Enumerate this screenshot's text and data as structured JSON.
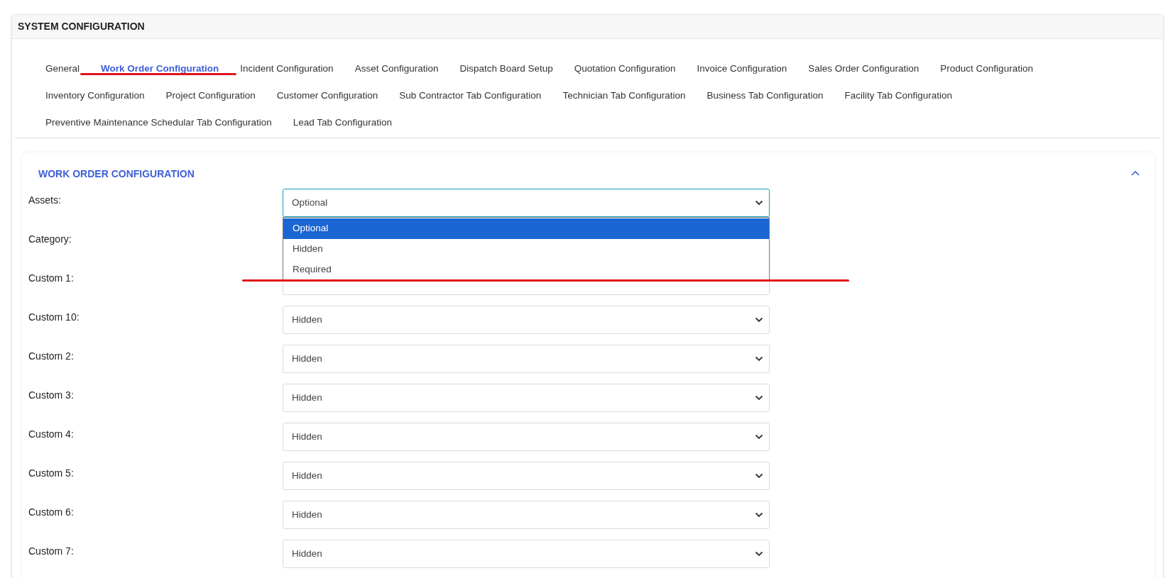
{
  "page_title": "SYSTEM CONFIGURATION",
  "tabs": [
    {
      "label": "General",
      "selected": false
    },
    {
      "label": "Work Order Configuration",
      "selected": true
    },
    {
      "label": "Incident Configuration",
      "selected": false
    },
    {
      "label": "Asset Configuration",
      "selected": false
    },
    {
      "label": "Dispatch Board Setup",
      "selected": false
    },
    {
      "label": "Quotation Configuration",
      "selected": false
    },
    {
      "label": "Invoice Configuration",
      "selected": false
    },
    {
      "label": "Sales Order Configuration",
      "selected": false
    },
    {
      "label": "Product Configuration",
      "selected": false
    },
    {
      "label": "Inventory Configuration",
      "selected": false
    },
    {
      "label": "Project Configuration",
      "selected": false
    },
    {
      "label": "Customer Configuration",
      "selected": false
    },
    {
      "label": "Sub Contractor Tab Configuration",
      "selected": false
    },
    {
      "label": "Technician Tab Configuration",
      "selected": false
    },
    {
      "label": "Business Tab Configuration",
      "selected": false
    },
    {
      "label": "Facility Tab Configuration",
      "selected": false
    },
    {
      "label": "Preventive Maintenance Schedular Tab Configuration",
      "selected": false
    },
    {
      "label": "Lead Tab Configuration",
      "selected": false
    }
  ],
  "section": {
    "title": "WORK ORDER CONFIGURATION",
    "expanded": true,
    "fields": [
      {
        "label": "Assets:",
        "value": "Optional",
        "focused": true,
        "open": true,
        "options": [
          {
            "label": "Optional",
            "selected": true
          },
          {
            "label": "Hidden",
            "selected": false
          },
          {
            "label": "Required",
            "selected": false
          }
        ]
      },
      {
        "label": "Category:"
      },
      {
        "label": "Custom 1:"
      },
      {
        "label": "Custom 10:",
        "value": "Hidden"
      },
      {
        "label": "Custom 2:",
        "value": "Hidden"
      },
      {
        "label": "Custom 3:",
        "value": "Hidden"
      },
      {
        "label": "Custom 4:",
        "value": "Hidden"
      },
      {
        "label": "Custom 5:",
        "value": "Hidden"
      },
      {
        "label": "Custom 6:",
        "value": "Hidden"
      },
      {
        "label": "Custom 7:",
        "value": "Hidden"
      }
    ]
  }
}
